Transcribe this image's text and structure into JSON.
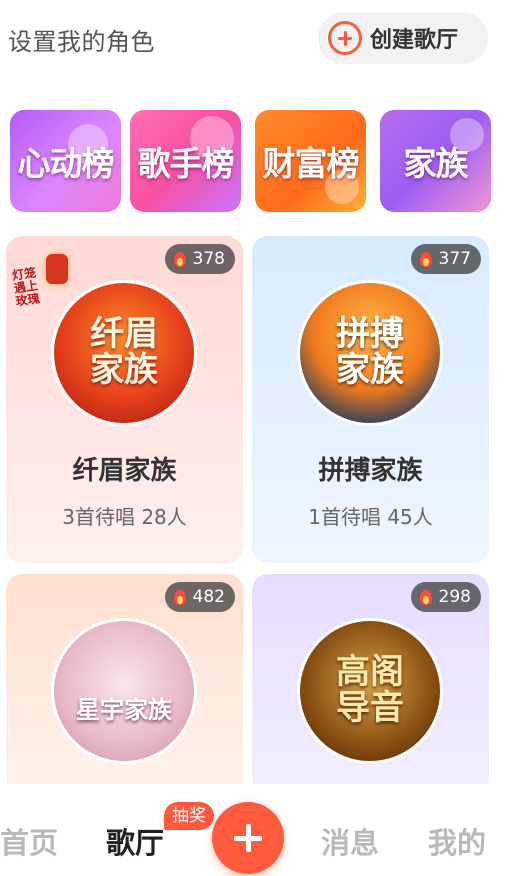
{
  "header": {
    "role_link": "设置我的角色",
    "create_hall_label": "创建歌厅"
  },
  "rankings": [
    {
      "label": "心动榜"
    },
    {
      "label": "歌手榜"
    },
    {
      "label": "财富榜"
    },
    {
      "label": "家族"
    }
  ],
  "halls": [
    {
      "name": "纤眉家族",
      "heat": "378",
      "subtitle": "3首待唱 28人",
      "avatar_text": "纤眉\n家族",
      "banner_text": "灯笼\n遇上\n玫瑰"
    },
    {
      "name": "拼搏家族",
      "heat": "377",
      "subtitle": "1首待唱 45人",
      "avatar_text": "拼搏\n家族"
    },
    {
      "name": "",
      "heat": "482",
      "subtitle": "",
      "avatar_text": "星宇家族"
    },
    {
      "name": "",
      "heat": "298",
      "subtitle": "",
      "avatar_text": "高阁\n导音"
    }
  ],
  "nav": {
    "home": "首页",
    "hall": "歌厅",
    "lottery_badge": "抽奖",
    "messages": "消息",
    "me": "我的"
  },
  "colors": {
    "accent": "#ff5a3c"
  }
}
